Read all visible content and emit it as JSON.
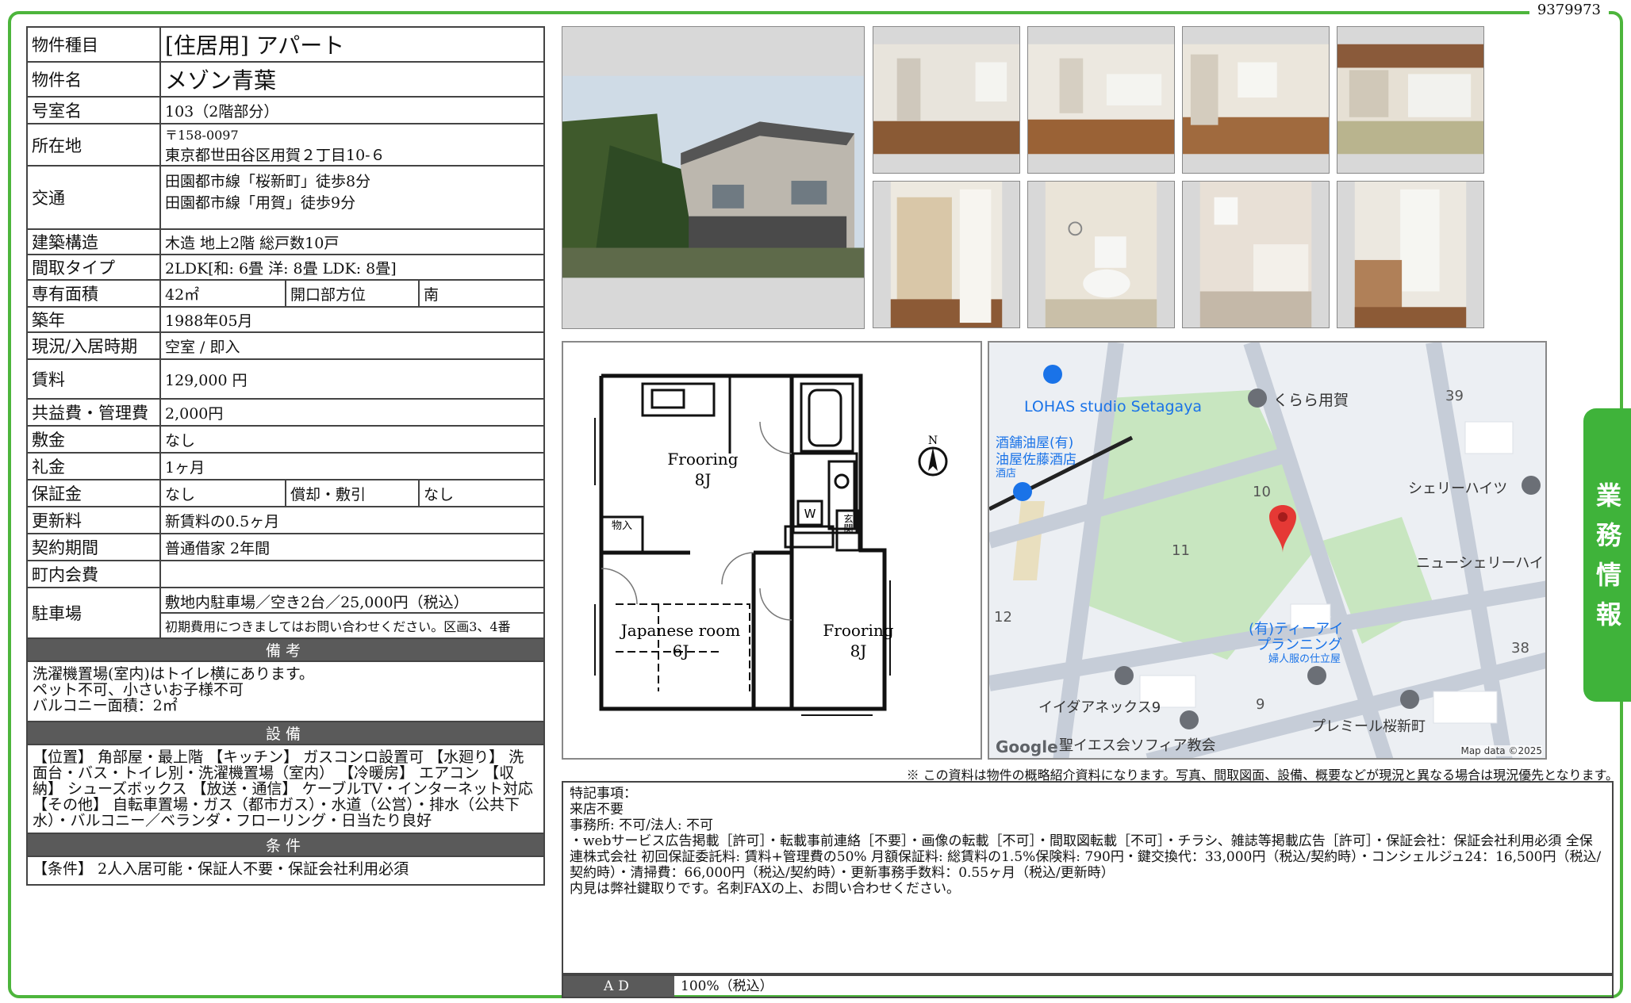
{
  "doc_number": "9379973",
  "side_tab": "業務情報",
  "spec": {
    "type_label": "物件種目",
    "type_value": "[住居用]  アパート",
    "name_label": "物件名",
    "name_value": "メゾン青葉",
    "room_label": "号室名",
    "room_value": "103（2階部分）",
    "address_label": "所在地",
    "postal": "〒158-0097",
    "address": "東京都世田谷区用賀２丁目10-６",
    "transport_label": "交通",
    "transport_1": "田園都市線「桜新町」徒歩8分",
    "transport_2": "田園都市線「用賀」徒歩9分",
    "structure_label": "建築構造",
    "structure_value": "木造 地上2階 総戸数10戸",
    "layout_label": "間取タイプ",
    "layout_value": "2LDK[和: 6畳 洋: 8畳 LDK: 8畳]",
    "area_label": "専有面積",
    "area_value": "42㎡",
    "orientation_label": "開口部方位",
    "orientation_value": "南",
    "built_label": "築年",
    "built_value": "1988年05月",
    "status_label": "現況/入居時期",
    "status_value": "空室 /  即入",
    "rent_label": "賃料",
    "rent_value": "129,000 円",
    "fee_label": "共益費・管理費",
    "fee_value": "2,000円",
    "deposit_label": "敷金",
    "deposit_value": "なし",
    "keymoney_label": "礼金",
    "keymoney_value": "1ヶ月",
    "guarantee_label": "保証金",
    "guarantee_value": "なし",
    "amort_label": "償却・敷引",
    "amort_value": "なし",
    "renewal_label": "更新料",
    "renewal_value": "新賃料の0.5ヶ月",
    "contract_label": "契約期間",
    "contract_value": "普通借家 2年間",
    "community_label": "町内会費",
    "community_value": "",
    "parking_label": "駐車場",
    "parking_1": "敷地内駐車場／空き2台／25,000円（税込）",
    "parking_2": "初期費用につきましてはお問い合わせください。区画3、4番",
    "remarks_header": "備考",
    "remarks_text": "洗濯機置場(室内)はトイレ横にあります。\nペット不可、小さいお子様不可\nバルコニー面積：2㎡",
    "equip_header": "設備",
    "equip_text": "【位置】 角部屋・最上階 【キッチン】 ガスコンロ設置可 【水廻り】 洗面台・バス・トイレ別・洗濯機置場（室内） 【冷暖房】 エアコン 【収納】 シューズボックス 【放送・通信】 ケーブルTV・インターネット対応 【その他】 自転車置場・ガス（都市ガス）・水道（公営）・排水（公共下水）・バルコニー／ベランダ・フローリング・日当たり良好",
    "cond_header": "条件",
    "cond_text": "【条件】 2人入居可能・保証人不要・保証会社利用必須"
  },
  "floorplan": {
    "room1": "Frooring",
    "room1_size": "8J",
    "room2": "Japanese room",
    "room2_size": "6J",
    "room3": "Frooring",
    "room3_size": "8J",
    "storage": "物入",
    "entrance": "玄関",
    "washer": "W",
    "north": "N"
  },
  "map": {
    "labels": [
      "LOHAS studio Setagaya",
      "くらら用賀",
      "39",
      "酒舗油屋(有)",
      "油屋佐藤酒店",
      "酒店",
      "10",
      "シェリーハイツ",
      "11",
      "ニューシェリーハイ",
      "12",
      "(有)ティーアイ",
      "プランニング",
      "婦人服の仕立屋",
      "38",
      "イイダアネックス9",
      "9",
      "プレミール桜新町",
      "聖イエス会ソフィア教会",
      "Google",
      "Map data ©2025"
    ],
    "colors": {
      "park": "#c8e6c0",
      "road": "#c6cdd8",
      "bg": "#eceff3",
      "pin": "#e53935",
      "poi": "#1a73e8"
    }
  },
  "note": "※ この資料は物件の概略紹介資料になります。写真、間取図面、設備、概要などが現況と異なる場合は現況優先となります。",
  "special": {
    "line1": "特記事項：",
    "line2": "来店不要",
    "line3": "事務所: 不可/法人: 不可",
    "line4": "・webサービス広告掲載［許可］・転載事前連絡［不要］・画像の転載［不可］・間取図転載［不可］・チラシ、雑誌等掲載広告［許可］・保証会社：保証会社利用必須 全保連株式会社 初回保証委託料: 賃料+管理費の50% 月額保証料: 総賃料の1.5%保険料: 790円・鍵交換代：33,000円（税込/契約時）・コンシェルジュ24：16,500円（税込/契約時）・清掃費：66,000円（税込/契約時）・更新事務手数料：0.55ヶ月（税込/更新時）",
    "line5": "内見は弊社鍵取りです。名刺FAXの上、お問い合わせください。"
  },
  "ad": {
    "label": "AD",
    "value": "100%（税込）"
  },
  "colors": {
    "frame": "#4db53c",
    "tab": "#3fb33a",
    "header": "#5a5a5a"
  }
}
